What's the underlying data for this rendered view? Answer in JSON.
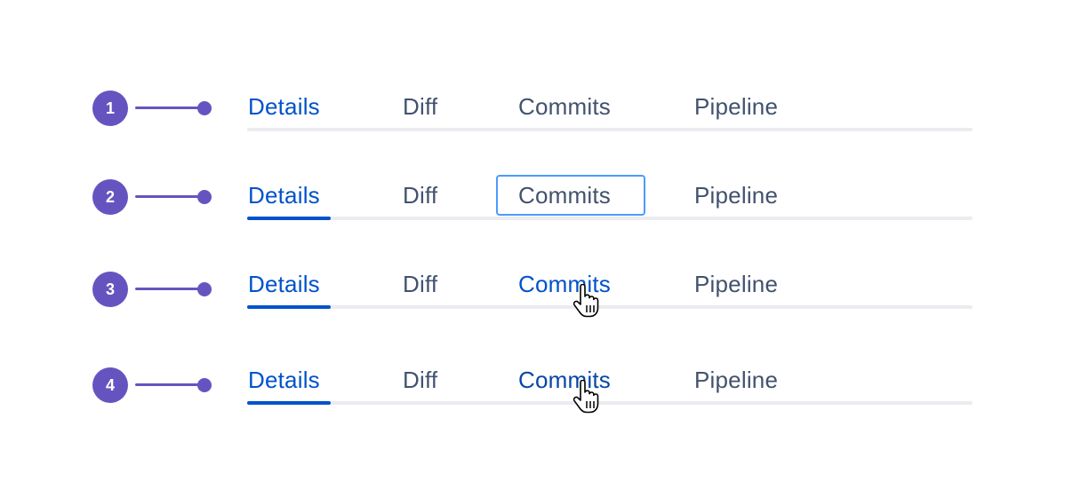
{
  "colors": {
    "marker": "#6554c0",
    "tab_default": "#42526e",
    "tab_selected": "#0052cc",
    "tab_pressed": "#0747a6",
    "focus_ring": "#4c9aff",
    "track": "#ebecf0"
  },
  "rows": [
    {
      "number": "1",
      "state": "unselected",
      "tabs": [
        "Details",
        "Diff",
        "Commits",
        "Pipeline"
      ]
    },
    {
      "number": "2",
      "state": "focused",
      "tabs": [
        "Details",
        "Diff",
        "Commits",
        "Pipeline"
      ]
    },
    {
      "number": "3",
      "state": "hover",
      "tabs": [
        "Details",
        "Diff",
        "Commits",
        "Pipeline"
      ]
    },
    {
      "number": "4",
      "state": "pressed",
      "tabs": [
        "Details",
        "Diff",
        "Commits",
        "Pipeline"
      ]
    }
  ],
  "icons": {
    "cursor": "hand-pointer-icon"
  }
}
